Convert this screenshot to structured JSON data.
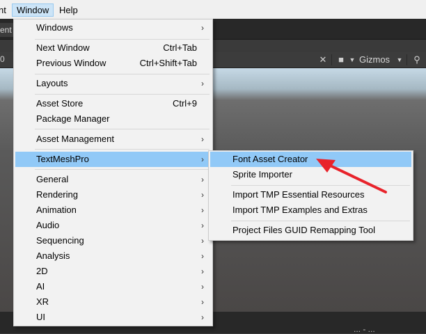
{
  "menubar": {
    "items": [
      {
        "label": "nt"
      },
      {
        "label": "Window"
      },
      {
        "label": "Help"
      }
    ]
  },
  "toolbar": {
    "tab_fragment": "ent",
    "zoom_fragment": "0",
    "gizmos_label": "Gizmos"
  },
  "window_menu": {
    "items": [
      {
        "label": "Windows",
        "submenu": true
      },
      {
        "label": "Next Window",
        "shortcut": "Ctrl+Tab"
      },
      {
        "label": "Previous Window",
        "shortcut": "Ctrl+Shift+Tab"
      },
      {
        "label": "Layouts",
        "submenu": true
      },
      {
        "label": "Asset Store",
        "shortcut": "Ctrl+9"
      },
      {
        "label": "Package Manager"
      },
      {
        "label": "Asset Management",
        "submenu": true
      },
      {
        "label": "TextMeshPro",
        "submenu": true,
        "highlighted": true
      },
      {
        "label": "General",
        "submenu": true
      },
      {
        "label": "Rendering",
        "submenu": true
      },
      {
        "label": "Animation",
        "submenu": true
      },
      {
        "label": "Audio",
        "submenu": true
      },
      {
        "label": "Sequencing",
        "submenu": true
      },
      {
        "label": "Analysis",
        "submenu": true
      },
      {
        "label": "2D",
        "submenu": true
      },
      {
        "label": "AI",
        "submenu": true
      },
      {
        "label": "XR",
        "submenu": true
      },
      {
        "label": "UI",
        "submenu": true
      }
    ]
  },
  "textmeshpro_submenu": {
    "items": [
      {
        "label": "Font Asset Creator",
        "highlighted": true
      },
      {
        "label": "Sprite Importer"
      },
      {
        "label": "Import TMP Essential Resources"
      },
      {
        "label": "Import TMP Examples and Extras"
      },
      {
        "label": "Project Files GUID Remapping Tool"
      }
    ]
  },
  "bottom": {
    "fragment": "... - ..."
  },
  "colors": {
    "highlight": "#91c9f7",
    "annotation_arrow": "#e8232b",
    "menubar_open": "#cce4f7"
  }
}
